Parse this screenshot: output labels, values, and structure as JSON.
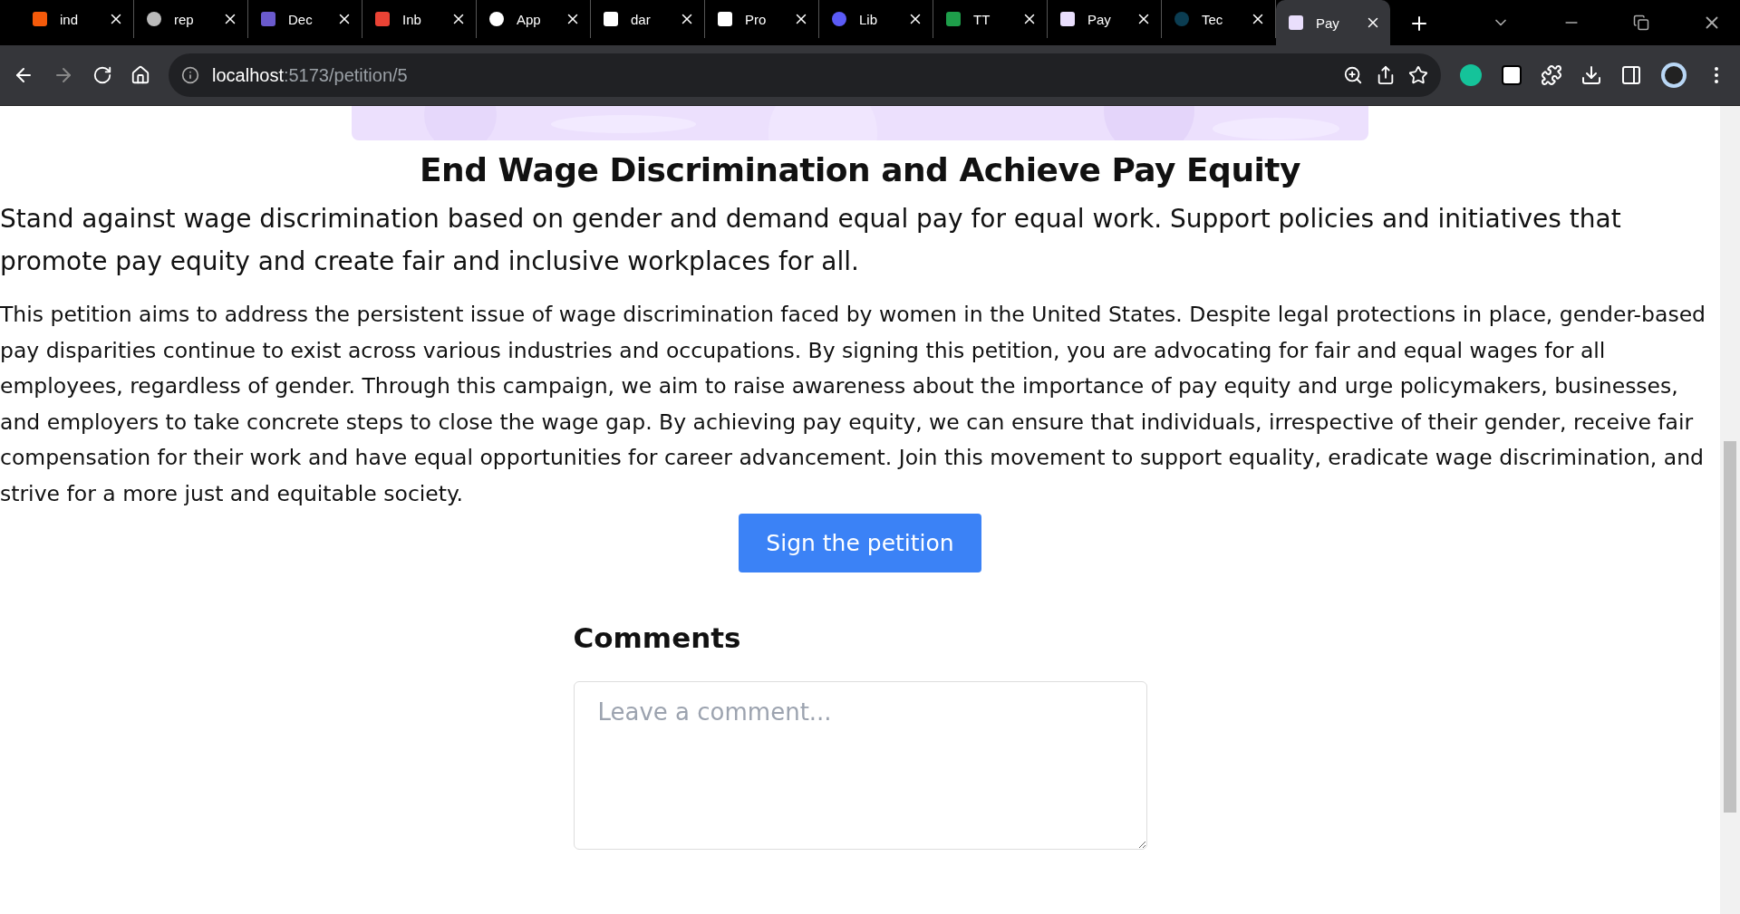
{
  "browser": {
    "tabs": [
      {
        "label": "ind",
        "selected": false
      },
      {
        "label": "rep",
        "selected": false
      },
      {
        "label": "Dec",
        "selected": false
      },
      {
        "label": "Inb",
        "selected": false
      },
      {
        "label": "App",
        "selected": false
      },
      {
        "label": "dar",
        "selected": false
      },
      {
        "label": "Pro",
        "selected": false
      },
      {
        "label": "Lib",
        "selected": false
      },
      {
        "label": "TT",
        "selected": false
      },
      {
        "label": "Pay",
        "selected": false
      },
      {
        "label": "Tec",
        "selected": false
      },
      {
        "label": "Pay",
        "selected": true
      }
    ],
    "address": {
      "host": "localhost",
      "path": ":5173/petition/5"
    }
  },
  "page": {
    "title": "End Wage Discrimination and Achieve Pay Equity",
    "summary": "Stand against wage discrimination based on gender and demand equal pay for equal work. Support policies and initiatives that promote pay equity and create fair and inclusive workplaces for all.",
    "description": "This petition aims to address the persistent issue of wage discrimination faced by women in the United States. Despite legal protections in place, gender-based pay disparities continue to exist across various industries and occupations. By signing this petition, you are advocating for fair and equal wages for all employees, regardless of gender. Through this campaign, we aim to raise awareness about the importance of pay equity and urge policymakers, businesses, and employers to take concrete steps to close the wage gap. By achieving pay equity, we can ensure that individuals, irrespective of their gender, receive fair compensation for their work and have equal opportunities for career advancement. Join this movement to support equality, eradicate wage discrimination, and strive for a more just and equitable society.",
    "sign_button": "Sign the petition",
    "comments": {
      "heading": "Comments",
      "placeholder": "Leave a comment..."
    }
  }
}
